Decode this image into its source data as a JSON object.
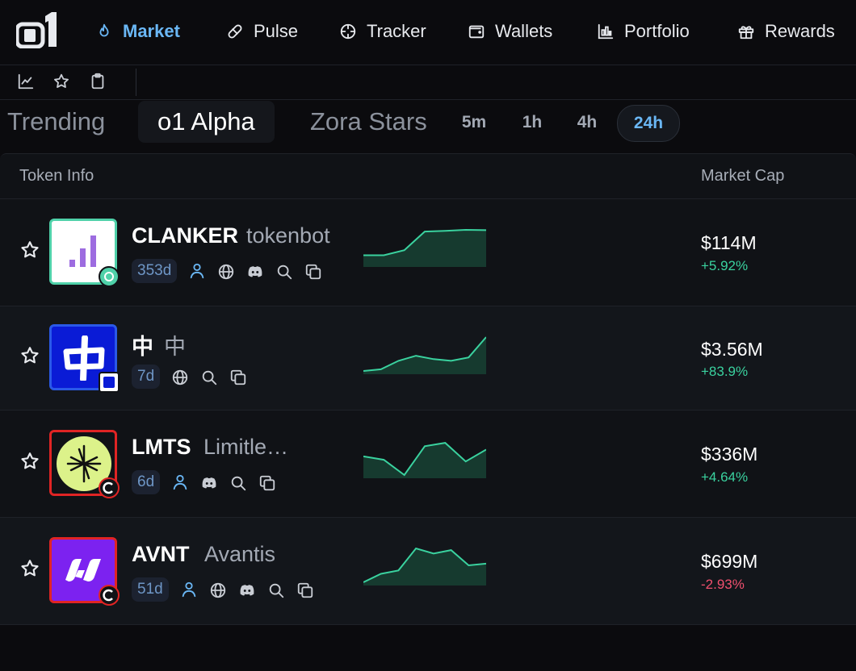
{
  "nav": {
    "items": [
      {
        "label": "Market",
        "icon": "flame-icon",
        "active": true
      },
      {
        "label": "Pulse",
        "icon": "pill-icon"
      },
      {
        "label": "Tracker",
        "icon": "crosshair-icon"
      },
      {
        "label": "Wallets",
        "icon": "wallet-icon"
      },
      {
        "label": "Portfolio",
        "icon": "bar-chart-icon"
      },
      {
        "label": "Rewards",
        "icon": "gift-icon"
      }
    ]
  },
  "toolbar": {
    "icons": [
      "chart-line-icon",
      "star-outline-icon",
      "clipboard-icon"
    ]
  },
  "tabs": [
    {
      "label": "Trending"
    },
    {
      "label": "o1 Alpha",
      "active": true
    },
    {
      "label": "Zora Stars"
    }
  ],
  "timeframes": [
    {
      "label": "5m"
    },
    {
      "label": "1h"
    },
    {
      "label": "4h"
    },
    {
      "label": "24h",
      "active": true
    }
  ],
  "table": {
    "headers": {
      "token_info": "Token Info",
      "market_cap": "Market Cap"
    },
    "rows": [
      {
        "symbol": "CLANKER",
        "name": "tokenbot",
        "age": "353d",
        "market_cap": "$114M",
        "change": "+5.92%",
        "change_color": "#3ad29f",
        "sparkline": [
          0.25,
          0.25,
          0.4,
          0.95,
          0.97,
          1.0,
          0.99
        ],
        "links": [
          "user-icon",
          "globe-icon",
          "discord-icon",
          "search-icon",
          "copy-icon"
        ]
      },
      {
        "symbol": "中",
        "name": "中",
        "age": "7d",
        "market_cap": "$3.56M",
        "change": "+83.9%",
        "change_color": "#3ad29f",
        "sparkline": [
          0.0,
          0.05,
          0.3,
          0.45,
          0.35,
          0.3,
          0.4,
          1.0
        ],
        "links": [
          "globe-icon",
          "search-icon",
          "copy-icon"
        ]
      },
      {
        "symbol": "LMTS",
        "name": "Limitle…",
        "age": "6d",
        "market_cap": "$336M",
        "change": "+4.64%",
        "change_color": "#3ad29f",
        "sparkline": [
          0.55,
          0.45,
          0.0,
          0.85,
          0.95,
          0.4,
          0.75
        ],
        "links": [
          "user-icon",
          "discord-icon",
          "search-icon",
          "copy-icon"
        ]
      },
      {
        "symbol": "AVNT",
        "name": "Avantis",
        "age": "51d",
        "market_cap": "$699M",
        "change": "-2.93%",
        "change_color": "#f0506e",
        "sparkline": [
          0.0,
          0.25,
          0.35,
          1.0,
          0.85,
          0.95,
          0.5,
          0.55
        ],
        "links": [
          "user-icon",
          "globe-icon",
          "discord-icon",
          "search-icon",
          "copy-icon"
        ]
      }
    ]
  },
  "colors": {
    "accent": "#6ab7f5",
    "positive": "#3ad29f",
    "negative": "#f0506e",
    "background": "#0b0b0e"
  }
}
